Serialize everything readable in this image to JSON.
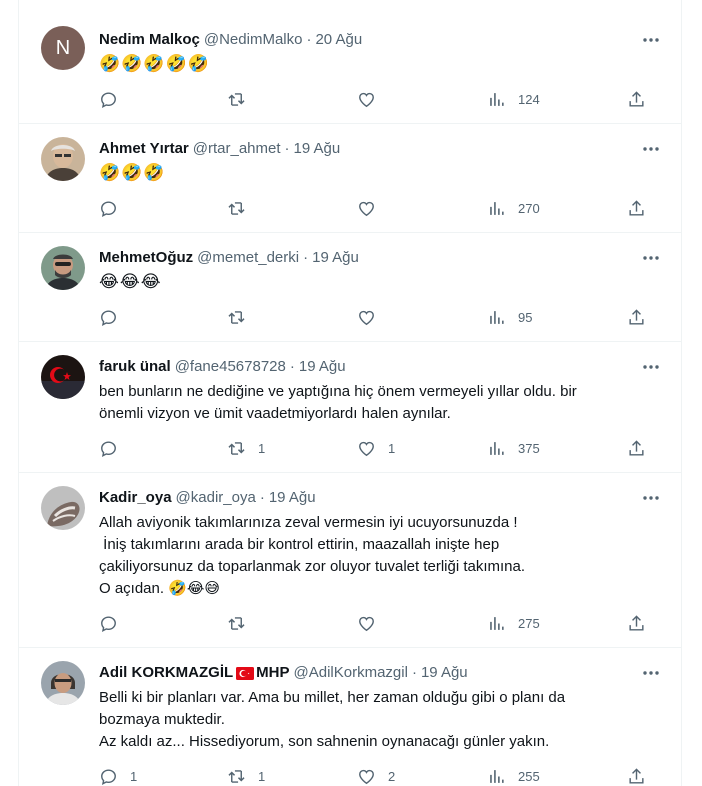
{
  "tweets": [
    {
      "name": "Nedim Malkoç",
      "handle": "@NedimMalko",
      "date": "20 Ağu",
      "lines": [
        "🤣🤣🤣🤣🤣"
      ],
      "replies": "",
      "retweets": "",
      "likes": "",
      "views": "124",
      "avatar_letter": "N"
    },
    {
      "name": "Ahmet Yırtar",
      "handle": "@rtar_ahmet",
      "date": "19 Ağu",
      "lines": [
        "🤣🤣🤣"
      ],
      "replies": "",
      "retweets": "",
      "likes": "",
      "views": "270"
    },
    {
      "name": "MehmetOğuz",
      "handle": "@memet_derki",
      "date": "19 Ağu",
      "lines": [
        "😂😂😂"
      ],
      "replies": "",
      "retweets": "",
      "likes": "",
      "views": "95"
    },
    {
      "name": "faruk ünal",
      "handle": "@fane45678728",
      "date": "19 Ağu",
      "lines": [
        "ben bunların ne dediğine ve yaptığına hiç önem vermeyeli yıllar oldu. bir",
        "önemli vizyon ve ümit vaadetmiyorlardı halen aynılar."
      ],
      "replies": "",
      "retweets": "1",
      "likes": "1",
      "views": "375"
    },
    {
      "name": "Kadir_oya",
      "handle": "@kadir_oya",
      "date": "19 Ağu",
      "lines": [
        "Allah aviyonik takımlarınıza zeval vermesin iyi ucuyorsunuzda !",
        " İniş takımlarını arada bir kontrol ettirin, maazallah inişte hep",
        "çakiliyorsunuz da toparlanmak zor oluyor tuvalet terliği takımına.",
        "O açıdan. 🤣😂😅"
      ],
      "replies": "",
      "retweets": "",
      "likes": "",
      "views": "275"
    },
    {
      "name": "Adil KORKMAZGİL",
      "party": "MHP",
      "handle": "@AdilKorkmazgil",
      "date": "19 Ağu",
      "lines": [
        "Belli ki bir planları var. Ama bu millet, her zaman olduğu gibi o planı da",
        "bozmaya muktedir.",
        "Az kaldı az... Hissediyorum, son sahnenin oynanacağı günler yakın."
      ],
      "replies": "1",
      "retweets": "1",
      "likes": "2",
      "views": "255"
    }
  ],
  "colors": {
    "text": "#0f1419",
    "muted": "#536471",
    "border": "#eff3f4",
    "flag_red": "#e30a17"
  },
  "icons": {
    "reply": "reply-icon",
    "retweet": "retweet-icon",
    "like": "heart-icon",
    "views": "views-icon",
    "share": "share-icon",
    "more": "more-icon"
  }
}
